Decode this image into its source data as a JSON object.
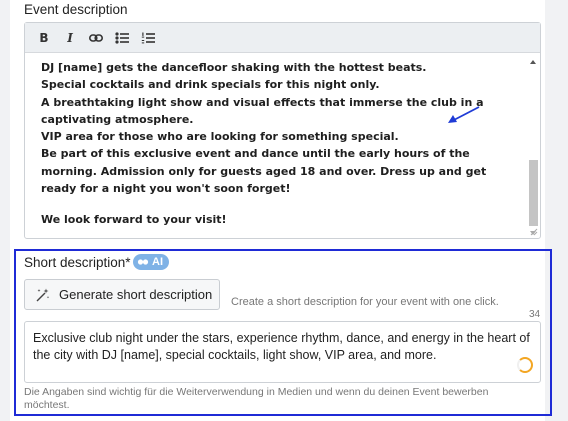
{
  "event_description": {
    "label": "Event description",
    "toolbar": {
      "bold_label": "B",
      "italic_label": "I",
      "link_icon": "link-icon",
      "bullet_list_icon": "bullet-list-icon",
      "numbered_list_icon": "numbered-list-icon"
    },
    "lines": [
      "DJ [name] gets the dancefloor shaking with the hottest beats.",
      "Special cocktails and drink specials for this night only.",
      "A breathtaking light show and visual effects that immerse the club in a captivating atmosphere.",
      "VIP area for those who are looking for something special.",
      "Be part of this exclusive event and dance until the early hours of the morning. Admission only for guests aged 18 and over. Dress up and get ready for a night you won't soon forget!"
    ],
    "closing": "We look forward to your visit!"
  },
  "short_description": {
    "label": "Short description*",
    "ai_badge": "AI",
    "generate_button": "Generate short description",
    "hint": "Create a short description for your event with one click.",
    "char_count": "34",
    "value": "Exclusive club night under the stars, experience rhythm, dance, and energy in the heart of the city with DJ [name], special cocktails, light show, VIP area, and more.",
    "footer_note": "Die Angaben sind wichtig für die Weiterverwendung in Medien und wenn du deinen Event bewerben möchtest."
  },
  "colors": {
    "highlight_border": "#1f2bd6",
    "ai_badge": "#7fb2e6",
    "spinner": "#f3a623",
    "annotation_arrow": "#1f3bd6"
  }
}
